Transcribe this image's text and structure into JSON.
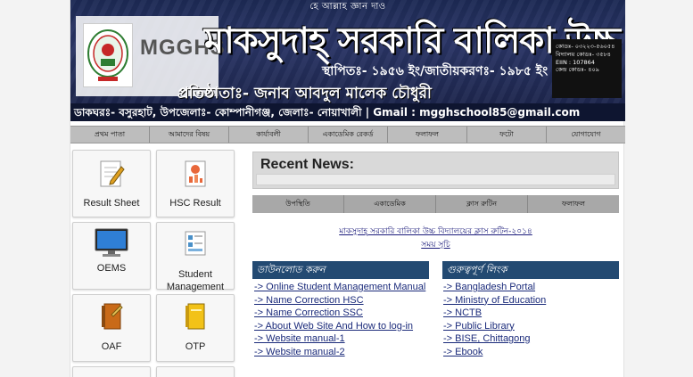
{
  "header": {
    "top_text": "হে আল্লাহ জ্ঞান দাও",
    "logo_text": "MGGHS",
    "school_name": "মাকসুদাহ্ সরকারি বালিকা উচ্চ বিদ্যালয়",
    "established": "স্থাপিতঃ- ১৯৫৬ ইং/জাতীয়করণঃ- ১৯৮৫ ইং",
    "founder": "প্রতিষ্ঠাতাঃ- জনাব আবদুল মালেক চৌধুরী",
    "address": "ডাকঘরঃ- বসুরহাট, উপজেলাঃ- কোম্পানীগঞ্জ, জেলাঃ- নোয়াখালী | Gmail : mgghschool85@gmail.com",
    "info_lines": [
      "কোডঃ- ০৩২২৩-৫৬০৫৪",
      "বিদ্যালয় কোডঃ- ৩৫৮৪",
      "EIIN : 107864",
      "কেন্দ্র কোডঃ- ৪০৯"
    ]
  },
  "nav": [
    "প্রথম পাতা",
    "আমাদের বিষয়",
    "কার্যাবলী",
    "একাডেমিক রেকর্ড",
    "ফলাফল",
    "ফটো",
    "যোগাযোগ"
  ],
  "tiles": [
    {
      "label": "Result Sheet",
      "icon": "result-sheet-icon"
    },
    {
      "label": "HSC Result",
      "icon": "hsc-result-icon"
    },
    {
      "label": "OEMS",
      "icon": "monitor-icon"
    },
    {
      "label": "Student Management",
      "icon": "student-management-icon"
    },
    {
      "label": "OAF",
      "icon": "oaf-book-icon"
    },
    {
      "label": "OTP",
      "icon": "otp-book-icon"
    }
  ],
  "recent_news": {
    "title": "Recent News:"
  },
  "tabs": [
    "উপস্থিতি",
    "একাডেমিক",
    "ক্লাস রুটিন",
    "ফলাফল"
  ],
  "routine_link": "মাকসুদাহ্ সরকারি বালিকা উচ্চ বিদ্যালয়ের ক্লাস রুটিন-২০১৪",
  "schedule_link": "সময় সূচি",
  "downloads": {
    "heading": "ডাউনলোড করুন",
    "items": [
      "-> Online Student Management Manual",
      "-> Name Correction HSC",
      "-> Name Correction SSC",
      "-> About Web Site And How to log-in",
      "-> Website manual-1",
      "-> Website manual-2"
    ]
  },
  "important_links": {
    "heading": "গুরুত্বপূর্ণ লিংক",
    "items": [
      "-> Bangladesh Portal",
      "-> Ministry of Education",
      "-> NCTB",
      "-> Public Library",
      "-> BISE, Chittagong",
      "-> Ebook"
    ]
  },
  "colors": {
    "panel_head": "#234a72",
    "banner": "#1d2a55",
    "nav": "#bdbdbd"
  }
}
